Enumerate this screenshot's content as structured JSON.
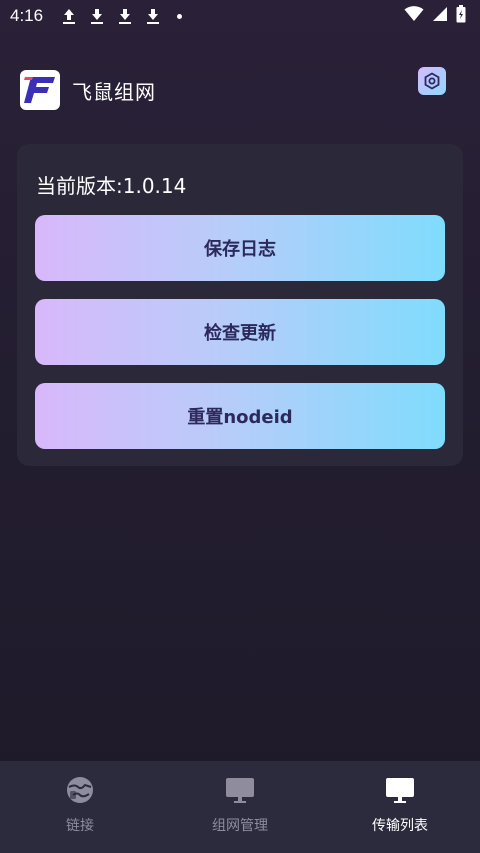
{
  "status_bar": {
    "time": "4:16",
    "icons": [
      "upload-icon",
      "download-icon",
      "download-icon",
      "download-icon",
      "dot-icon",
      "wifi-icon",
      "signal-icon",
      "battery-icon"
    ]
  },
  "header": {
    "title": "飞鼠组网",
    "logo_letter": "F",
    "settings_icon": "settings-hex-icon"
  },
  "card": {
    "version_text": "当前版本:1.0.14",
    "buttons": [
      {
        "label": "保存日志"
      },
      {
        "label": "检查更新"
      },
      {
        "label": "重置nodeid"
      }
    ]
  },
  "bottom_nav": {
    "items": [
      {
        "label": "链接",
        "icon": "globe-link-icon",
        "active": false
      },
      {
        "label": "组网管理",
        "icon": "monitor-icon",
        "active": false
      },
      {
        "label": "传输列表",
        "icon": "monitor-icon",
        "active": true
      }
    ]
  },
  "colors": {
    "accent_start": "#d8b8fb",
    "accent_end": "#7fdcfd",
    "button_text": "#2c2a5c",
    "card_bg": "#2a2839",
    "nav_bg": "#2c2a3d"
  }
}
